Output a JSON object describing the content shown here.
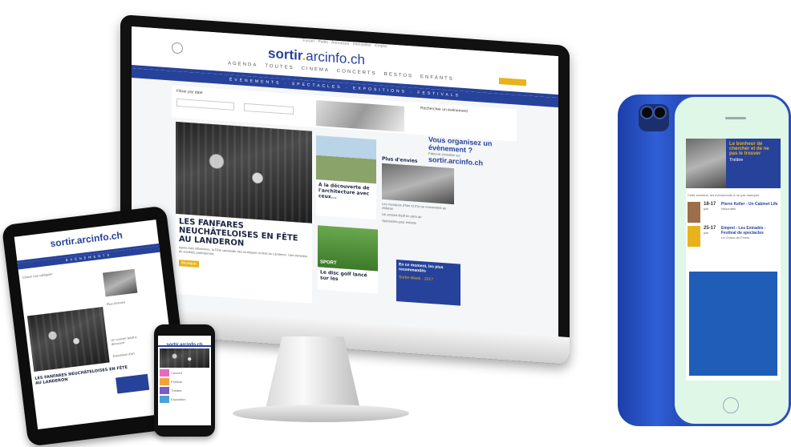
{
  "desktop": {
    "top_links": "Forum · Petits · Annonces · Immobilier · Emploi",
    "logo": {
      "main": "sortir",
      "dot": ".",
      "domain": "arcinfo.ch"
    },
    "nav_items": [
      "AGENDA",
      "TOUTES",
      "CINEMA",
      "CONCERTS",
      "RESTOS",
      "ENFANTS"
    ],
    "subnav": "ÉVÈNEMENTS · SPECTACLES · EXPOSITIONS · FESTIVALS",
    "filter_label": "Filtrer par date",
    "search_label": "Rechercher un évènement",
    "promo": {
      "title": "Vous organisez un évènement ?",
      "subtitle": "Faites-le connaître sur",
      "logo": "sortir.arcinfo.ch"
    },
    "main_headline": "LES FANFARES NEUCHÂTELOISES EN FÊTE AU LANDERON",
    "main_excerpt": "Après trois décennies, la Fête cantonale des musiques revient au Landeron. Une trentaine de sociétés participeront.",
    "main_badge": "Musique",
    "side_headline": "À la découverte de l'architecture avec ceux...",
    "sport_headline": "Le disc golf lancé sur les",
    "sport_label": "SPORT",
    "col_title": "Plus d'envies",
    "col_items": [
      "Les musiques d'hier et d'ici se rencontrent au château",
      "Un concert festif en plein air",
      "Spectacles pour enfants"
    ],
    "quote": "En ce moment, les plus recommandés",
    "quote_link": "Sortie-Week - 2017"
  },
  "tablet": {
    "logo": "sortir.arcinfo.ch",
    "section": "ÉVÈNEMENTS",
    "filter": "Choisir une catégorie",
    "headline": "LES FANFARES NEUCHÂTELOISES EN FÊTE AU LANDERON",
    "side_items": [
      "Plus d'envies",
      "Un concert festif à découvrir",
      "Exposition d'art"
    ]
  },
  "phone_small": {
    "logo": "sortir.arcinfo.ch",
    "items": [
      "Concert",
      "Festival",
      "Théâtre",
      "Exposition"
    ]
  },
  "iphone": {
    "feature_title": "Le bonheur de chercher et de ne pas le trouver",
    "feature_sub": "Théâtre",
    "section_label": "Cette semaine, les événements à ne pas manquer",
    "events": [
      {
        "dates": "18-17",
        "month": "juin",
        "title": "Pierre Keller - Un Cabinet Life",
        "place": "Neuchâtel"
      },
      {
        "dates": "25-17",
        "month": "juin",
        "title": "Emprel - Les Extradés - Festival de spectacles",
        "place": "La Chaux-de-Fonds"
      }
    ]
  },
  "colors": {
    "brand_blue": "#27429a",
    "accent_yellow": "#e8b21a",
    "iphone_blue": "#2f5ed6"
  }
}
